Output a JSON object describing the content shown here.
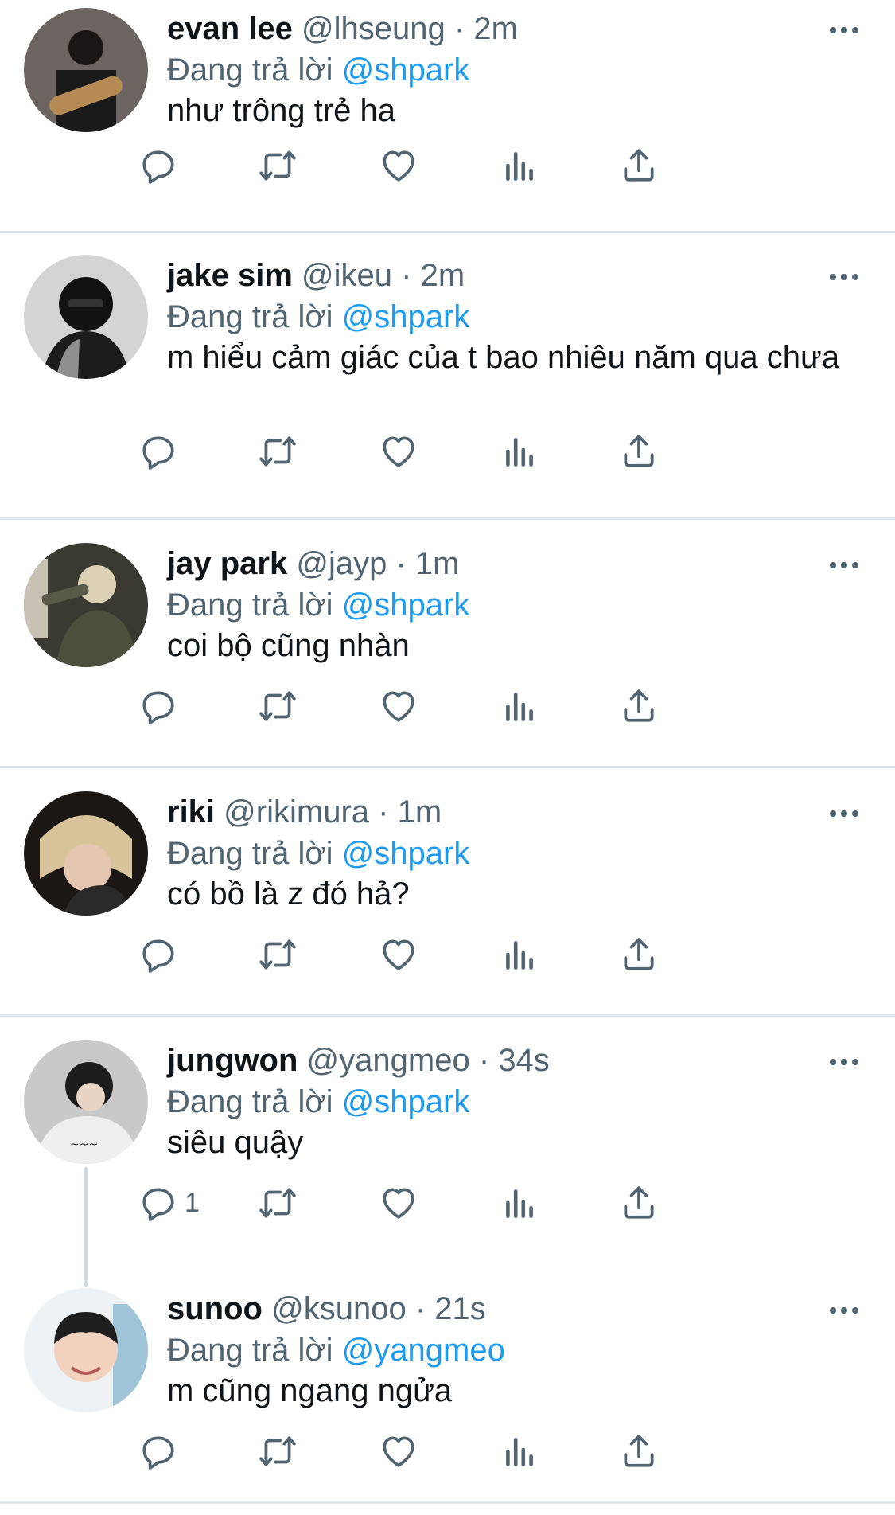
{
  "reply_label": "Đang trả lời",
  "tweets": [
    {
      "name": "evan lee",
      "handle": "@lhseung",
      "time": "2m",
      "reply_to": "@shpark",
      "text": "như trông trẻ ha",
      "reply_count": ""
    },
    {
      "name": "jake sim",
      "handle": "@ikeu",
      "time": "2m",
      "reply_to": "@shpark",
      "text": "m hiểu cảm giác của t bao nhiêu năm qua chưa",
      "reply_count": ""
    },
    {
      "name": "jay park",
      "handle": "@jayp",
      "time": "1m",
      "reply_to": "@shpark",
      "text": "coi bộ cũng nhàn",
      "reply_count": ""
    },
    {
      "name": "riki",
      "handle": "@rikimura",
      "time": "1m",
      "reply_to": "@shpark",
      "text": "có bồ là z đó hả?",
      "reply_count": ""
    },
    {
      "name": "jungwon",
      "handle": "@yangmeo",
      "time": "34s",
      "reply_to": "@shpark",
      "text": "siêu quậy",
      "reply_count": "1"
    },
    {
      "name": "sunoo",
      "handle": "@ksunoo",
      "time": "21s",
      "reply_to": "@yangmeo",
      "text": "m cũng ngang ngửa",
      "reply_count": ""
    }
  ],
  "icons": {
    "reply": "reply-icon",
    "retweet": "retweet-icon",
    "like": "heart-icon",
    "views": "analytics-icon",
    "share": "share-icon",
    "more": "more-icon"
  },
  "colors": {
    "link": "#1d9bf0",
    "secondary_text": "#536471",
    "divider": "#e3e6e8"
  }
}
